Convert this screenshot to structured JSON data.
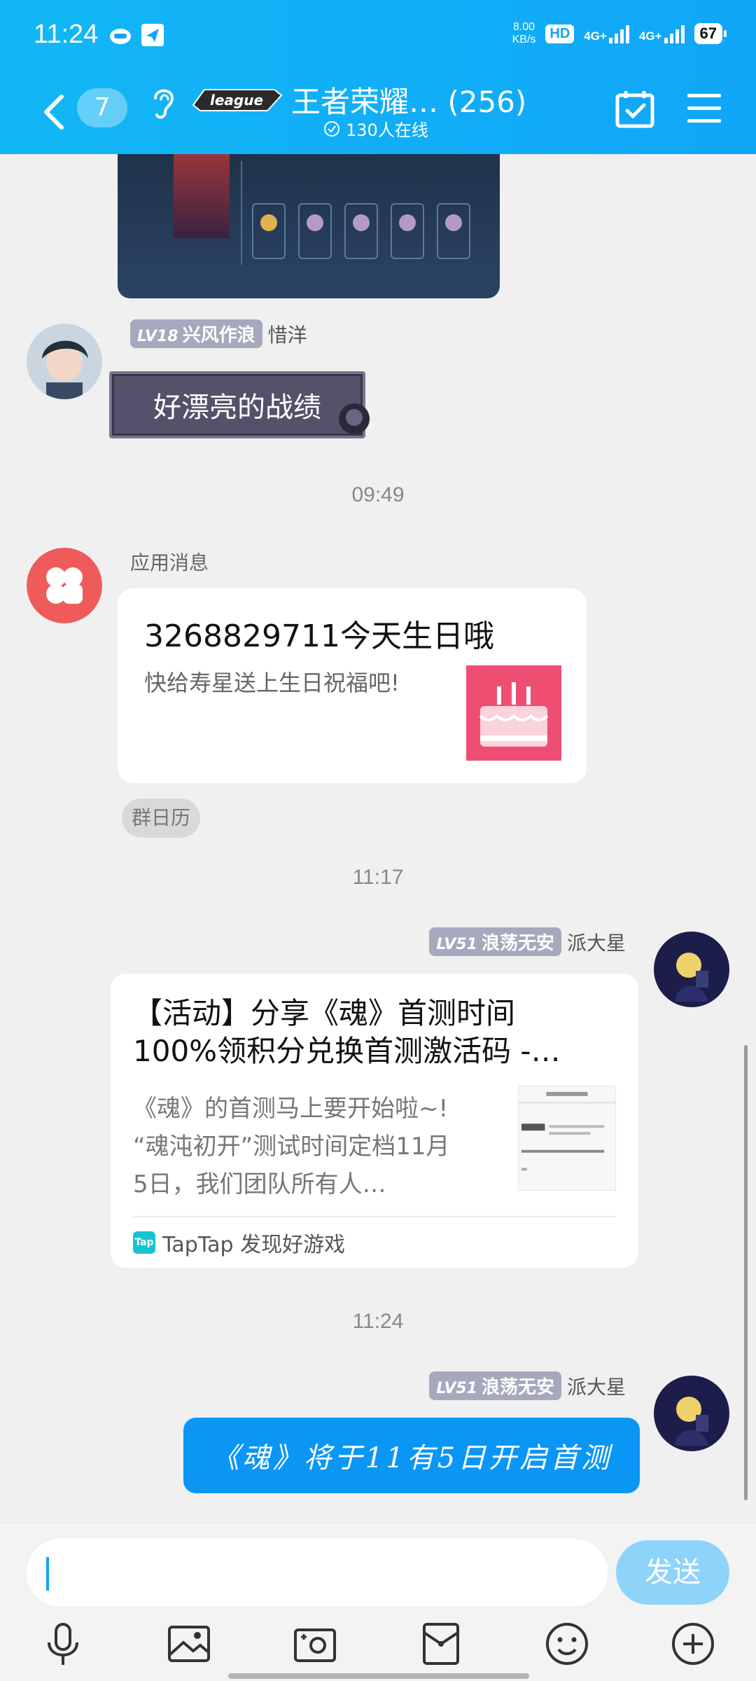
{
  "status_bar": {
    "time": "11:24",
    "net_speed_value": "8.00",
    "net_speed_unit": "KB/s",
    "hd_label": "HD",
    "sim1_label": "4G+",
    "sim2_label": "4G+",
    "battery": "67"
  },
  "header": {
    "unread_count": "7",
    "group_logo_text": "league",
    "group_title": "王者荣耀… (256)",
    "online_text": "130人在线"
  },
  "messages": {
    "msg1": {
      "level": "LV18",
      "title": "兴风作浪",
      "sender": "惜洋",
      "text": "好漂亮的战绩"
    },
    "time1": "09:49",
    "app": {
      "sender": "应用消息",
      "title": "3268829711今天生日哦",
      "body": "快给寿星送上生日祝福吧!",
      "tag": "群日历"
    },
    "time2": "11:17",
    "msg2": {
      "level": "LV51",
      "title": "浪荡无安",
      "sender": "派大星",
      "title_line1": "【活动】分享《魂》首测时间",
      "title_line2": "100%领积分兑换首测激活码 -…",
      "desc_line1": "《魂》的首测马上要开始啦~!",
      "desc_line2": "“魂沌初开”测试时间定档11月",
      "desc_line3": "5日，我们团队所有人…",
      "source_logo": "Tap",
      "source": "TapTap 发现好游戏"
    },
    "time3": "11:24",
    "msg3": {
      "level": "LV51",
      "title": "浪荡无安",
      "sender": "派大星",
      "text": "《魂》将于11有5日开启首测"
    }
  },
  "input": {
    "placeholder": "",
    "send_label": "发送"
  },
  "colors": {
    "header": "#12b7f5",
    "bubble": "#0a96f5",
    "send_button": "#8ed3fa"
  }
}
